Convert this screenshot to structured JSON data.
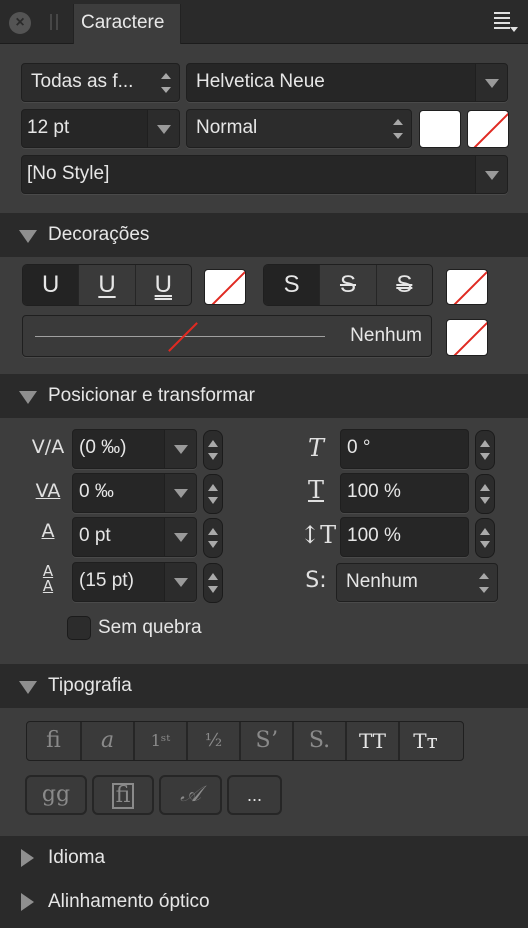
{
  "titlebar": {
    "tab_label": "Caractere",
    "close_icon": "×"
  },
  "font": {
    "collection": "Todas as f...",
    "family": "Helvetica Neue",
    "size": "12 pt",
    "weight": "Normal",
    "style": "[No Style]"
  },
  "colors": {
    "fill": "#ffffff",
    "none_stroke": "#e02a22"
  },
  "decorations": {
    "title": "Decorações",
    "underline_buttons": [
      "U",
      "U",
      "U"
    ],
    "strike_buttons": [
      "S",
      "S",
      "S"
    ],
    "line_style": "Nenhum"
  },
  "position": {
    "title": "Posicionar e transformar",
    "kerning": "(0 ‰)",
    "tracking": "0 ‰",
    "baseline": "0 pt",
    "leading": "(15 pt)",
    "no_break": "Sem quebra",
    "shear": "0 °",
    "hscale": "100 %",
    "vscale": "100 %",
    "scripts": "Nenhum",
    "icons": {
      "kerning": "V/A",
      "tracking": "VA",
      "baseline": "A",
      "leading": "A",
      "shear": "T",
      "hscale": "T",
      "vscale": "↕T",
      "scripts": "S:"
    }
  },
  "typography": {
    "title": "Tipografia",
    "row1": [
      "ﬁ",
      "a",
      "1ˢᵗ",
      "½",
      "Sʼ",
      "S.",
      "TT",
      "Tᴛ"
    ],
    "row2": [
      "gg",
      "ﬁ",
      "𝒜",
      "..."
    ]
  },
  "collapsed_sections": [
    "Idioma",
    "Alinhamento óptico"
  ]
}
